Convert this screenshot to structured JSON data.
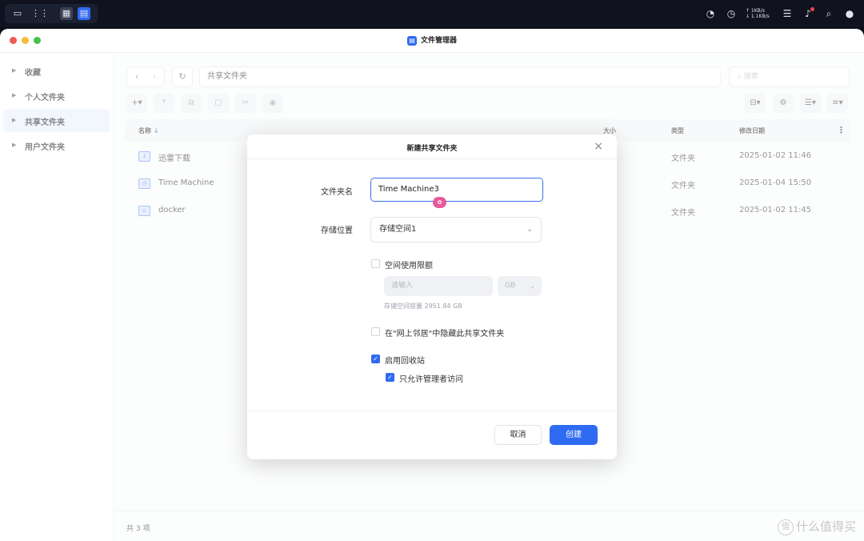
{
  "system_bar": {
    "network_up": "↑ 1KB/s",
    "network_down": "↓ 1.1KB/s",
    "icons": [
      "chat-icon",
      "apps-grid-icon",
      "calculator-icon",
      "file-manager-icon",
      "speedometer-icon",
      "clock-icon",
      "list-icon",
      "bell-icon",
      "search-icon",
      "user-icon"
    ]
  },
  "window": {
    "title": "文件管理器"
  },
  "sidebar": {
    "items": [
      {
        "label": "收藏"
      },
      {
        "label": "个人文件夹"
      },
      {
        "label": "共享文件夹"
      },
      {
        "label": "用户文件夹"
      }
    ]
  },
  "toolbar": {
    "path": "共享文件夹",
    "search_placeholder": "搜索"
  },
  "table": {
    "columns": [
      "名称",
      "大小",
      "类型",
      "修改日期"
    ],
    "rows": [
      {
        "name": "迅雷下载",
        "size": "",
        "type": "文件夹",
        "modified": "2025-01-02 11:46"
      },
      {
        "name": "Time Machine",
        "size": "",
        "type": "文件夹",
        "modified": "2025-01-04 15:50"
      },
      {
        "name": "docker",
        "size": "",
        "type": "文件夹",
        "modified": "2025-01-02 11:45"
      }
    ]
  },
  "status": {
    "count": "共 3 项"
  },
  "watermark": {
    "text": "什么值得买"
  },
  "dialog": {
    "title": "新建共享文件夹",
    "name_label": "文件夹名",
    "name_value": "Time Machine3",
    "location_label": "存储位置",
    "location_value": "存储空间1",
    "quota_checkbox_label": "空间使用限额",
    "quota_placeholder": "请输入",
    "quota_unit": "GB",
    "capacity_text": "存储空间容量 2951.84 GB",
    "hide_checkbox_label": "在\"网上邻居\"中隐藏此共享文件夹",
    "recycle_checkbox_label": "启用回收站",
    "admin_only_checkbox_label": "只允许管理者访问",
    "cancel_label": "取消",
    "create_label": "创建"
  },
  "colors": {
    "accent": "#2f6bf2",
    "system_bar": "#10131f"
  }
}
